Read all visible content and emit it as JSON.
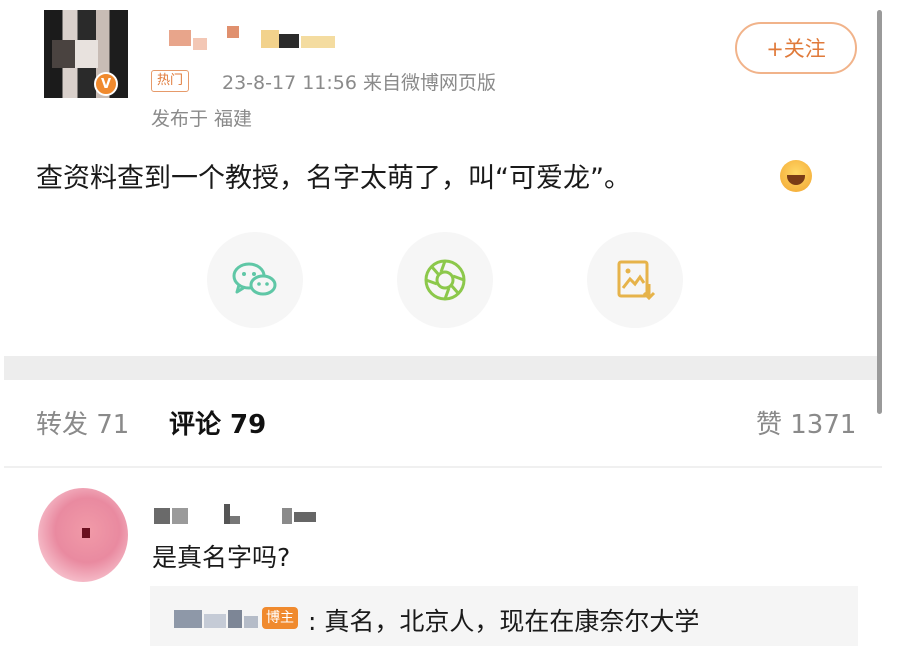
{
  "post": {
    "badge_hot": "热门",
    "meta": "23-8-17 11:56  来自微博网页版",
    "location": "发布于 福建",
    "follow_label": "+关注",
    "verified_mark": "V",
    "content": "查资料查到一个教授，名字太萌了，叫“可爱龙”。"
  },
  "share_icons": [
    "wechat-icon",
    "moments-icon",
    "save-image-icon"
  ],
  "tabs": {
    "repost": "转发 71",
    "comments": "评论 79",
    "likes": "赞 1371"
  },
  "comment": {
    "text": "是真名字吗?",
    "reply": {
      "badge": "博主",
      "text": ": 真名，北京人，现在在康奈尔大学"
    }
  },
  "colors": {
    "accent": "#f08a2e",
    "muted_text": "#8a8a8a",
    "divider": "#ededed"
  }
}
